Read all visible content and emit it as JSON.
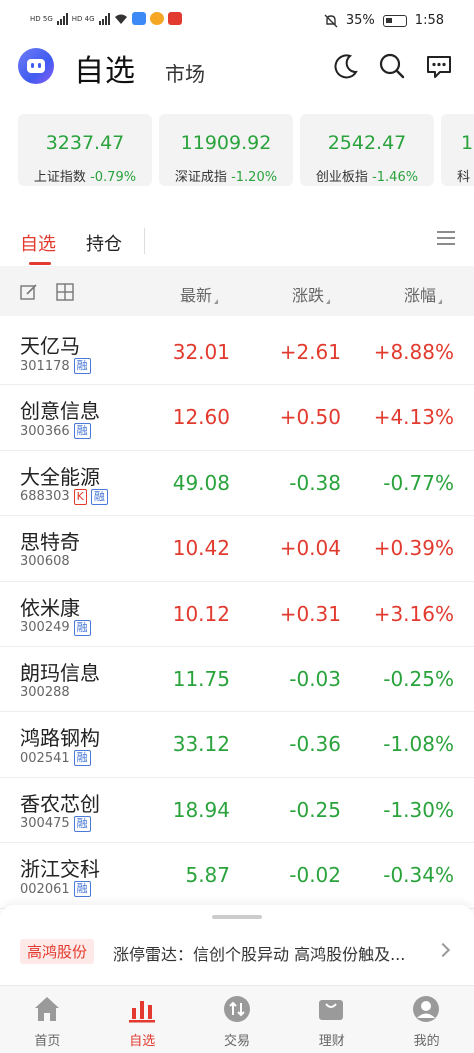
{
  "status": {
    "network_left": "HD 5G",
    "network_right": "HD 4G",
    "battery": "35%",
    "time": "1:58"
  },
  "header": {
    "title": "自选",
    "subtitle": "市场"
  },
  "indices": [
    {
      "value": "3237.47",
      "name": "上证指数",
      "change": "-0.79%"
    },
    {
      "value": "11909.92",
      "name": "深证成指",
      "change": "-1.20%"
    },
    {
      "value": "2542.47",
      "name": "创业板指",
      "change": "-1.46%"
    },
    {
      "value": "1",
      "name": "科",
      "change": ""
    }
  ],
  "tabs": [
    {
      "label": "自选",
      "active": true
    },
    {
      "label": "持仓",
      "active": false
    }
  ],
  "columns": {
    "latest": "最新",
    "change": "涨跌",
    "change_pct": "涨幅"
  },
  "stocks": [
    {
      "name": "天亿马",
      "code": "301178",
      "tags": [
        "融"
      ],
      "price": "32.01",
      "change": "+2.61",
      "pct": "+8.88%",
      "dir": "up"
    },
    {
      "name": "创意信息",
      "code": "300366",
      "tags": [
        "融"
      ],
      "price": "12.60",
      "change": "+0.50",
      "pct": "+4.13%",
      "dir": "up"
    },
    {
      "name": "大全能源",
      "code": "688303",
      "tags": [
        "K",
        "融"
      ],
      "price": "49.08",
      "change": "-0.38",
      "pct": "-0.77%",
      "dir": "down"
    },
    {
      "name": "思特奇",
      "code": "300608",
      "tags": [],
      "price": "10.42",
      "change": "+0.04",
      "pct": "+0.39%",
      "dir": "up"
    },
    {
      "name": "依米康",
      "code": "300249",
      "tags": [
        "融"
      ],
      "price": "10.12",
      "change": "+0.31",
      "pct": "+3.16%",
      "dir": "up"
    },
    {
      "name": "朗玛信息",
      "code": "300288",
      "tags": [],
      "price": "11.75",
      "change": "-0.03",
      "pct": "-0.25%",
      "dir": "down"
    },
    {
      "name": "鸿路钢构",
      "code": "002541",
      "tags": [
        "融"
      ],
      "price": "33.12",
      "change": "-0.36",
      "pct": "-1.08%",
      "dir": "down"
    },
    {
      "name": "香农芯创",
      "code": "300475",
      "tags": [
        "融"
      ],
      "price": "18.94",
      "change": "-0.25",
      "pct": "-1.30%",
      "dir": "down"
    },
    {
      "name": "浙江交科",
      "code": "002061",
      "tags": [
        "融"
      ],
      "price": "5.87",
      "change": "-0.02",
      "pct": "-0.34%",
      "dir": "down"
    }
  ],
  "news": {
    "badge": "高鸿股份",
    "text": "涨停雷达：信创个股异动 高鸿股份触及..."
  },
  "nav": [
    {
      "label": "首页",
      "icon": "home-icon",
      "active": false
    },
    {
      "label": "自选",
      "icon": "watchlist-icon",
      "active": true
    },
    {
      "label": "交易",
      "icon": "trade-icon",
      "active": false
    },
    {
      "label": "理财",
      "icon": "wealth-icon",
      "active": false
    },
    {
      "label": "我的",
      "icon": "profile-icon",
      "active": false
    }
  ],
  "colors": {
    "up": "#e23a2e",
    "down": "#2aa33c",
    "accent": "#e23a2e",
    "tag_blue": "#4a79d8"
  }
}
